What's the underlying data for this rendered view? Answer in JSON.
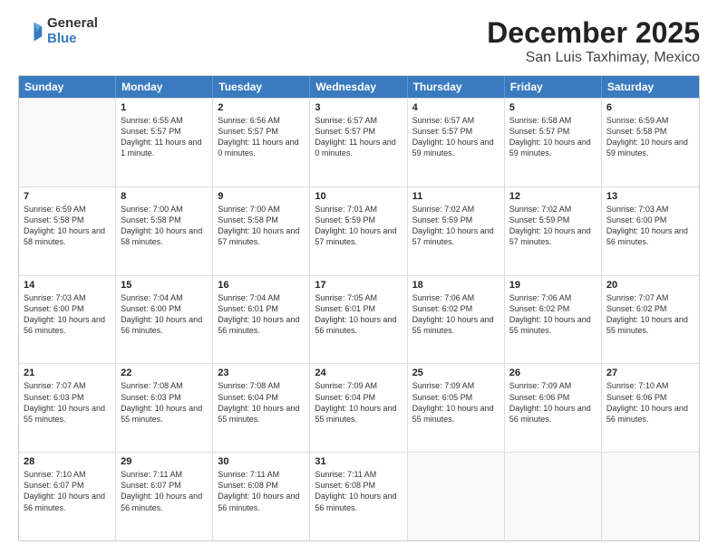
{
  "header": {
    "logo": {
      "line1": "General",
      "line2": "Blue"
    },
    "title": "December 2025",
    "subtitle": "San Luis Taxhimay, Mexico"
  },
  "days_of_week": [
    "Sunday",
    "Monday",
    "Tuesday",
    "Wednesday",
    "Thursday",
    "Friday",
    "Saturday"
  ],
  "weeks": [
    [
      {
        "day": "",
        "empty": true
      },
      {
        "day": "1",
        "sunrise": "Sunrise: 6:55 AM",
        "sunset": "Sunset: 5:57 PM",
        "daylight": "Daylight: 11 hours and 1 minute."
      },
      {
        "day": "2",
        "sunrise": "Sunrise: 6:56 AM",
        "sunset": "Sunset: 5:57 PM",
        "daylight": "Daylight: 11 hours and 0 minutes."
      },
      {
        "day": "3",
        "sunrise": "Sunrise: 6:57 AM",
        "sunset": "Sunset: 5:57 PM",
        "daylight": "Daylight: 11 hours and 0 minutes."
      },
      {
        "day": "4",
        "sunrise": "Sunrise: 6:57 AM",
        "sunset": "Sunset: 5:57 PM",
        "daylight": "Daylight: 10 hours and 59 minutes."
      },
      {
        "day": "5",
        "sunrise": "Sunrise: 6:58 AM",
        "sunset": "Sunset: 5:57 PM",
        "daylight": "Daylight: 10 hours and 59 minutes."
      },
      {
        "day": "6",
        "sunrise": "Sunrise: 6:59 AM",
        "sunset": "Sunset: 5:58 PM",
        "daylight": "Daylight: 10 hours and 59 minutes."
      }
    ],
    [
      {
        "day": "7",
        "sunrise": "Sunrise: 6:59 AM",
        "sunset": "Sunset: 5:58 PM",
        "daylight": "Daylight: 10 hours and 58 minutes."
      },
      {
        "day": "8",
        "sunrise": "Sunrise: 7:00 AM",
        "sunset": "Sunset: 5:58 PM",
        "daylight": "Daylight: 10 hours and 58 minutes."
      },
      {
        "day": "9",
        "sunrise": "Sunrise: 7:00 AM",
        "sunset": "Sunset: 5:58 PM",
        "daylight": "Daylight: 10 hours and 57 minutes."
      },
      {
        "day": "10",
        "sunrise": "Sunrise: 7:01 AM",
        "sunset": "Sunset: 5:59 PM",
        "daylight": "Daylight: 10 hours and 57 minutes."
      },
      {
        "day": "11",
        "sunrise": "Sunrise: 7:02 AM",
        "sunset": "Sunset: 5:59 PM",
        "daylight": "Daylight: 10 hours and 57 minutes."
      },
      {
        "day": "12",
        "sunrise": "Sunrise: 7:02 AM",
        "sunset": "Sunset: 5:59 PM",
        "daylight": "Daylight: 10 hours and 57 minutes."
      },
      {
        "day": "13",
        "sunrise": "Sunrise: 7:03 AM",
        "sunset": "Sunset: 6:00 PM",
        "daylight": "Daylight: 10 hours and 56 minutes."
      }
    ],
    [
      {
        "day": "14",
        "sunrise": "Sunrise: 7:03 AM",
        "sunset": "Sunset: 6:00 PM",
        "daylight": "Daylight: 10 hours and 56 minutes."
      },
      {
        "day": "15",
        "sunrise": "Sunrise: 7:04 AM",
        "sunset": "Sunset: 6:00 PM",
        "daylight": "Daylight: 10 hours and 56 minutes."
      },
      {
        "day": "16",
        "sunrise": "Sunrise: 7:04 AM",
        "sunset": "Sunset: 6:01 PM",
        "daylight": "Daylight: 10 hours and 56 minutes."
      },
      {
        "day": "17",
        "sunrise": "Sunrise: 7:05 AM",
        "sunset": "Sunset: 6:01 PM",
        "daylight": "Daylight: 10 hours and 56 minutes."
      },
      {
        "day": "18",
        "sunrise": "Sunrise: 7:06 AM",
        "sunset": "Sunset: 6:02 PM",
        "daylight": "Daylight: 10 hours and 55 minutes."
      },
      {
        "day": "19",
        "sunrise": "Sunrise: 7:06 AM",
        "sunset": "Sunset: 6:02 PM",
        "daylight": "Daylight: 10 hours and 55 minutes."
      },
      {
        "day": "20",
        "sunrise": "Sunrise: 7:07 AM",
        "sunset": "Sunset: 6:02 PM",
        "daylight": "Daylight: 10 hours and 55 minutes."
      }
    ],
    [
      {
        "day": "21",
        "sunrise": "Sunrise: 7:07 AM",
        "sunset": "Sunset: 6:03 PM",
        "daylight": "Daylight: 10 hours and 55 minutes."
      },
      {
        "day": "22",
        "sunrise": "Sunrise: 7:08 AM",
        "sunset": "Sunset: 6:03 PM",
        "daylight": "Daylight: 10 hours and 55 minutes."
      },
      {
        "day": "23",
        "sunrise": "Sunrise: 7:08 AM",
        "sunset": "Sunset: 6:04 PM",
        "daylight": "Daylight: 10 hours and 55 minutes."
      },
      {
        "day": "24",
        "sunrise": "Sunrise: 7:09 AM",
        "sunset": "Sunset: 6:04 PM",
        "daylight": "Daylight: 10 hours and 55 minutes."
      },
      {
        "day": "25",
        "sunrise": "Sunrise: 7:09 AM",
        "sunset": "Sunset: 6:05 PM",
        "daylight": "Daylight: 10 hours and 55 minutes."
      },
      {
        "day": "26",
        "sunrise": "Sunrise: 7:09 AM",
        "sunset": "Sunset: 6:06 PM",
        "daylight": "Daylight: 10 hours and 56 minutes."
      },
      {
        "day": "27",
        "sunrise": "Sunrise: 7:10 AM",
        "sunset": "Sunset: 6:06 PM",
        "daylight": "Daylight: 10 hours and 56 minutes."
      }
    ],
    [
      {
        "day": "28",
        "sunrise": "Sunrise: 7:10 AM",
        "sunset": "Sunset: 6:07 PM",
        "daylight": "Daylight: 10 hours and 56 minutes."
      },
      {
        "day": "29",
        "sunrise": "Sunrise: 7:11 AM",
        "sunset": "Sunset: 6:07 PM",
        "daylight": "Daylight: 10 hours and 56 minutes."
      },
      {
        "day": "30",
        "sunrise": "Sunrise: 7:11 AM",
        "sunset": "Sunset: 6:08 PM",
        "daylight": "Daylight: 10 hours and 56 minutes."
      },
      {
        "day": "31",
        "sunrise": "Sunrise: 7:11 AM",
        "sunset": "Sunset: 6:08 PM",
        "daylight": "Daylight: 10 hours and 56 minutes."
      },
      {
        "day": "",
        "empty": true
      },
      {
        "day": "",
        "empty": true
      },
      {
        "day": "",
        "empty": true
      }
    ]
  ]
}
